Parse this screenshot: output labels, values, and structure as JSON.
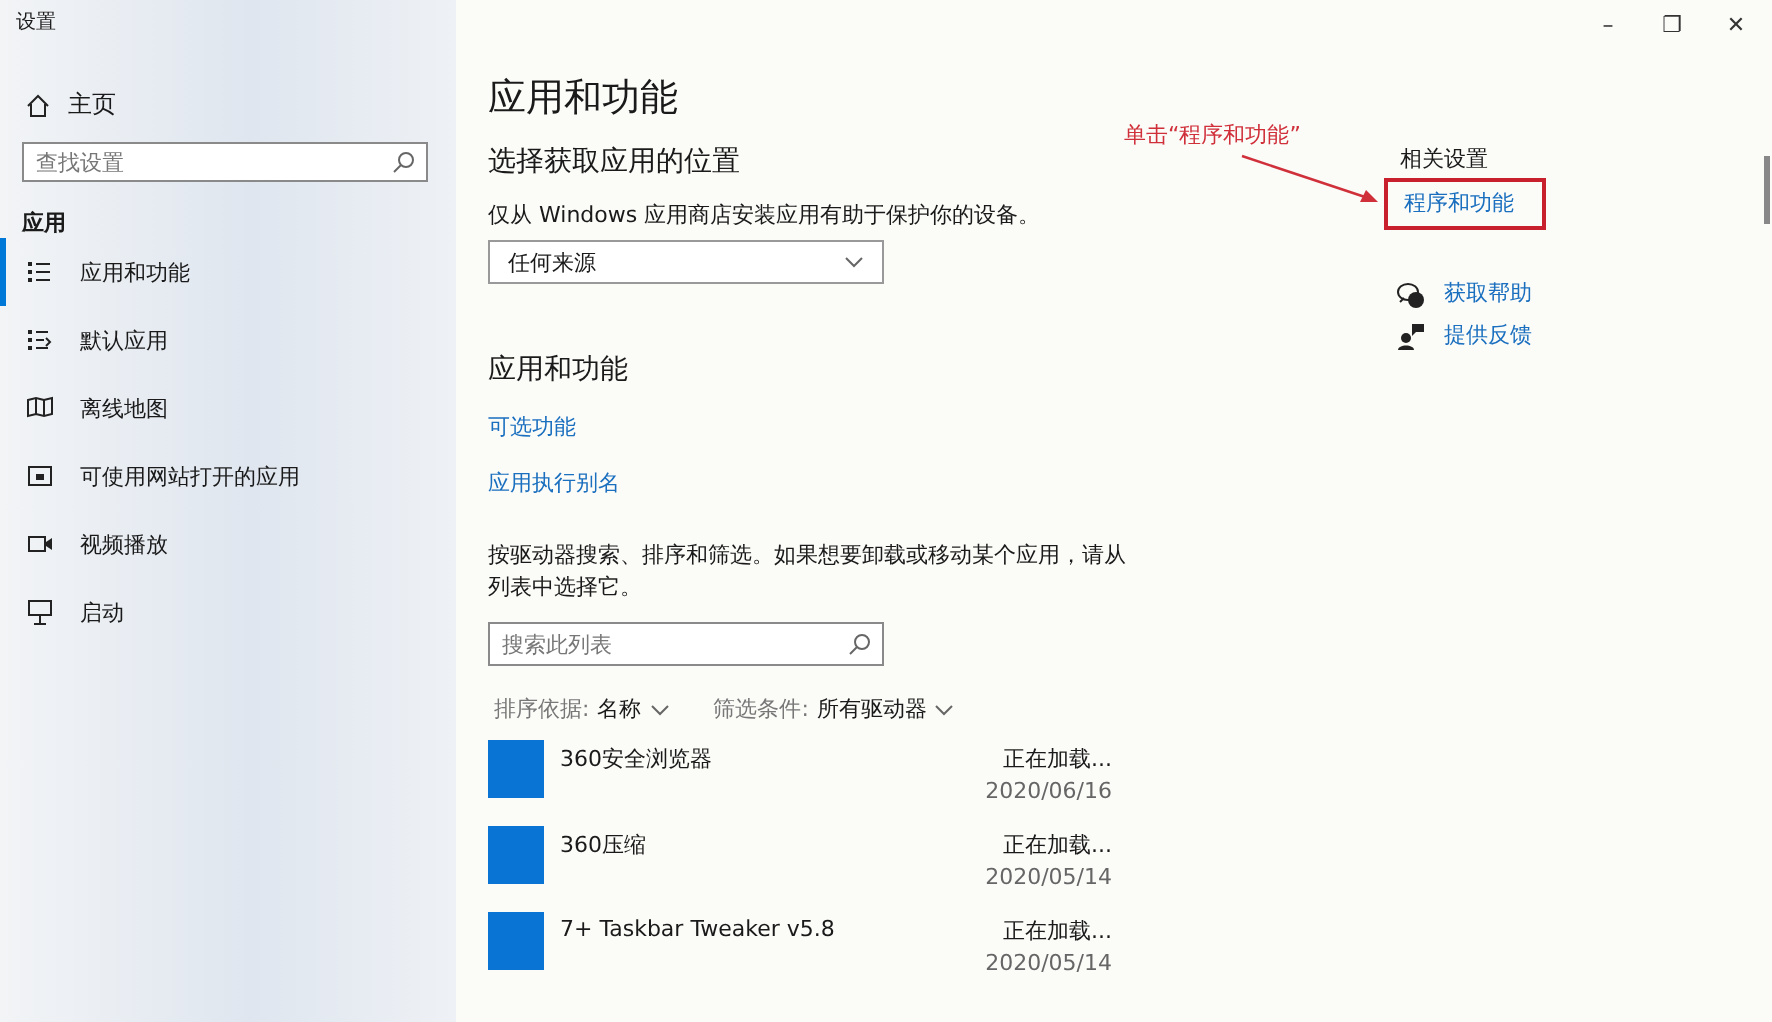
{
  "window": {
    "title": "设置",
    "controls": [
      "–",
      "❐",
      "✕"
    ]
  },
  "sidebar": {
    "home": "主页",
    "search": {
      "placeholder": "查找设置"
    },
    "section": "应用",
    "items": [
      {
        "label": "应用和功能",
        "kind": "list",
        "selected": true
      },
      {
        "label": "默认应用",
        "kind": "default",
        "selected": false
      },
      {
        "label": "离线地图",
        "kind": "map",
        "selected": false
      },
      {
        "label": "可使用网站打开的应用",
        "kind": "web",
        "selected": false
      },
      {
        "label": "视频播放",
        "kind": "video",
        "selected": false
      },
      {
        "label": "启动",
        "kind": "startup",
        "selected": false
      }
    ]
  },
  "main": {
    "title": "应用和功能",
    "source_heading": "选择获取应用的位置",
    "source_text": "仅从 Windows 应用商店安装应用有助于保护你的设备。",
    "source_dropdown": "任何来源",
    "apps_heading": "应用和功能",
    "links": [
      "可选功能",
      "应用执行别名"
    ],
    "description": "按驱动器搜索、排序和筛选。如果想要卸载或移动某个应用，请从列表中选择它。",
    "list_search": {
      "placeholder": "搜索此列表"
    },
    "sort": {
      "label": "排序依据:",
      "value": "名称"
    },
    "filter": {
      "label": "筛选条件:",
      "value": "所有驱动器"
    },
    "apps": [
      {
        "name": "360安全浏览器",
        "size": "正在加载...",
        "date": "2020/06/16"
      },
      {
        "name": "360压缩",
        "size": "正在加载...",
        "date": "2020/05/14"
      },
      {
        "name": "7+ Taskbar Tweaker v5.8",
        "size": "正在加载...",
        "date": "2020/05/14"
      }
    ]
  },
  "related": {
    "heading": "相关设置",
    "link": "程序和功能",
    "highlighted": true,
    "help": [
      {
        "label": "获取帮助",
        "kind": "help"
      },
      {
        "label": "提供反馈",
        "kind": "feedback"
      }
    ]
  },
  "annotation": {
    "text": "单击“程序和功能”"
  }
}
